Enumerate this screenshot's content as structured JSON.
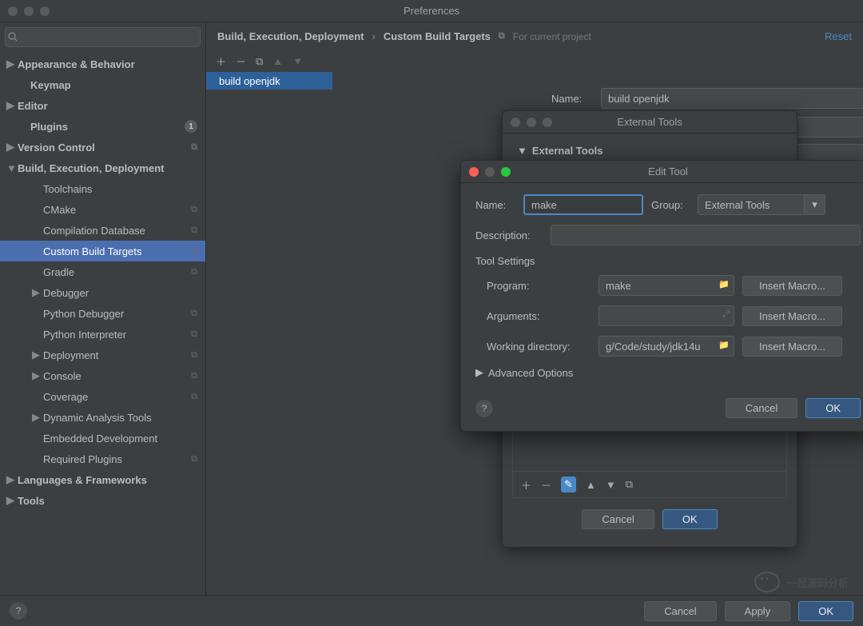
{
  "window_title": "Preferences",
  "search_placeholder": "",
  "sidebar": {
    "items": [
      {
        "label": "Appearance & Behavior",
        "arrow": "▶",
        "lvl": 0
      },
      {
        "label": "Keymap",
        "arrow": "",
        "lvl": 1
      },
      {
        "label": "Editor",
        "arrow": "▶",
        "lvl": 0
      },
      {
        "label": "Plugins",
        "arrow": "",
        "lvl": 1,
        "badge": "1"
      },
      {
        "label": "Version Control",
        "arrow": "▶",
        "lvl": 0,
        "copy": true
      },
      {
        "label": "Build, Execution, Deployment",
        "arrow": "▼",
        "lvl": 0,
        "expanded": true
      },
      {
        "label": "Toolchains",
        "arrow": "",
        "lvl": 2
      },
      {
        "label": "CMake",
        "arrow": "",
        "lvl": 2,
        "copy": true
      },
      {
        "label": "Compilation Database",
        "arrow": "",
        "lvl": 2,
        "copy": true
      },
      {
        "label": "Custom Build Targets",
        "arrow": "",
        "lvl": 2,
        "copy": true,
        "selected": true
      },
      {
        "label": "Gradle",
        "arrow": "",
        "lvl": 2,
        "copy": true
      },
      {
        "label": "Debugger",
        "arrow": "▶",
        "lvl": 2
      },
      {
        "label": "Python Debugger",
        "arrow": "",
        "lvl": 2,
        "copy": true
      },
      {
        "label": "Python Interpreter",
        "arrow": "",
        "lvl": 2,
        "copy": true
      },
      {
        "label": "Deployment",
        "arrow": "▶",
        "lvl": 2,
        "copy": true
      },
      {
        "label": "Console",
        "arrow": "▶",
        "lvl": 2,
        "copy": true
      },
      {
        "label": "Coverage",
        "arrow": "",
        "lvl": 2,
        "copy": true
      },
      {
        "label": "Dynamic Analysis Tools",
        "arrow": "▶",
        "lvl": 2
      },
      {
        "label": "Embedded Development",
        "arrow": "",
        "lvl": 2
      },
      {
        "label": "Required Plugins",
        "arrow": "",
        "lvl": 2,
        "copy": true
      },
      {
        "label": "Languages & Frameworks",
        "arrow": "▶",
        "lvl": 0
      },
      {
        "label": "Tools",
        "arrow": "▶",
        "lvl": 0
      }
    ]
  },
  "breadcrumb": {
    "p1": "Build, Execution, Deployment",
    "sep": "›",
    "p2": "Custom Build Targets",
    "for_project": "For current project",
    "reset": "Reset"
  },
  "target": {
    "tab_label": "build openjdk",
    "name_label": "Name:",
    "name_value": "build openjdk"
  },
  "ext_tools": {
    "title": "External Tools",
    "header": "External Tools",
    "cancel": "Cancel",
    "ok": "OK"
  },
  "edit_tool": {
    "title": "Edit Tool",
    "name_label": "Name:",
    "name_value": "make",
    "group_label": "Group:",
    "group_value": "External Tools",
    "desc_label": "Description:",
    "desc_value": "",
    "tool_settings": "Tool Settings",
    "program_label": "Program:",
    "program_value": "make",
    "args_label": "Arguments:",
    "args_value": "",
    "wd_label": "Working directory:",
    "wd_value": "g/Code/study/jdk14u",
    "insert_macro": "Insert Macro...",
    "advanced": "Advanced Options",
    "cancel": "Cancel",
    "ok": "OK"
  },
  "footer": {
    "cancel": "Cancel",
    "apply": "Apply",
    "ok": "OK"
  },
  "watermark": "一起源码分析"
}
